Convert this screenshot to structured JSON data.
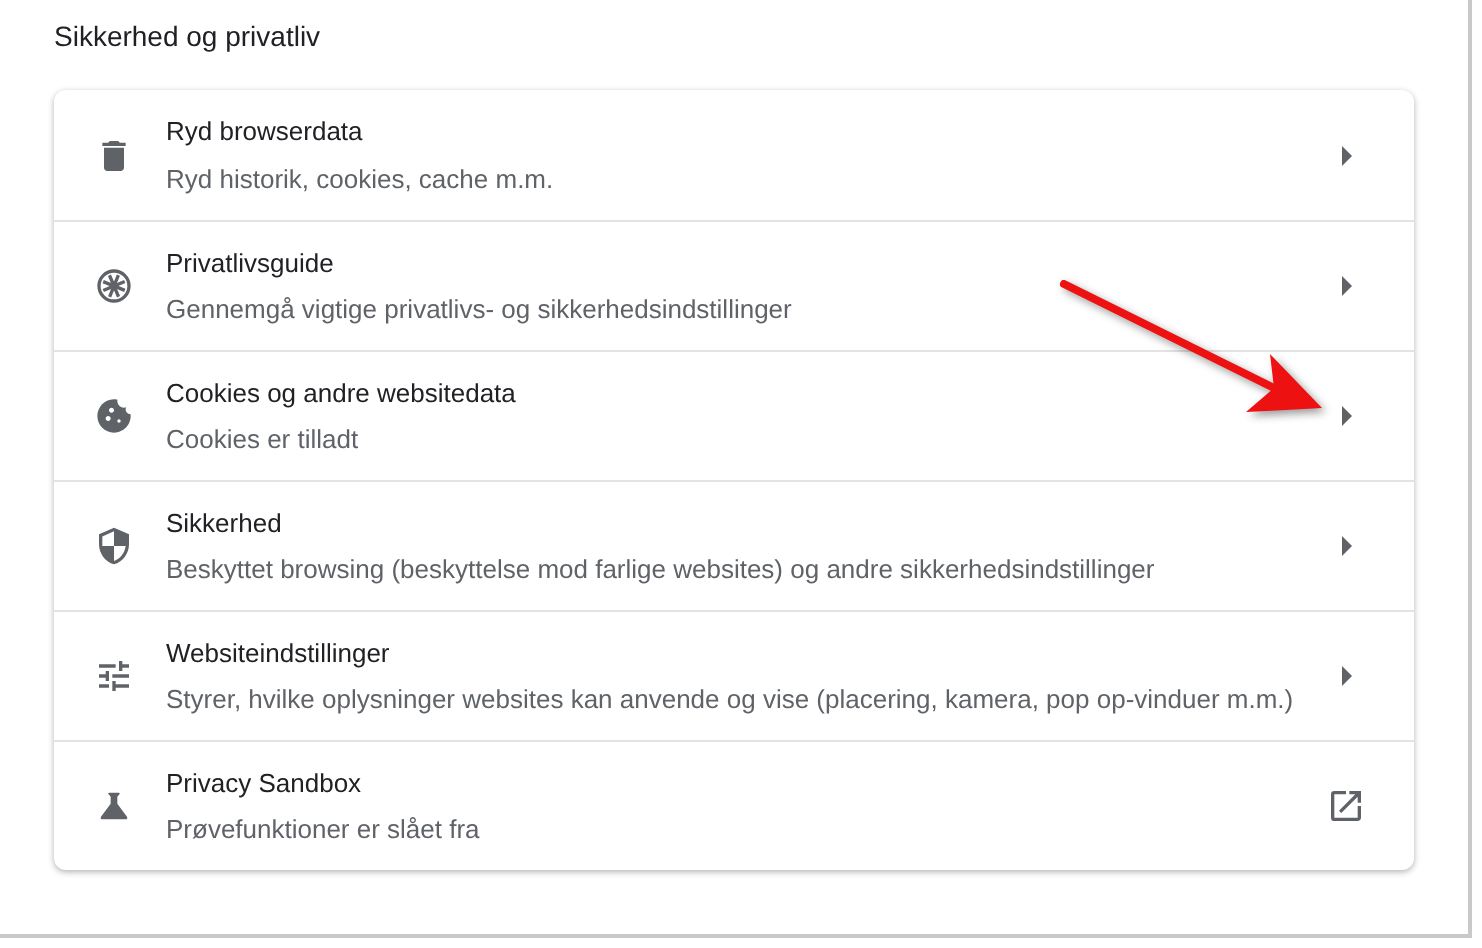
{
  "section_title": "Sikkerhed og privatliv",
  "items": [
    {
      "title": "Ryd browserdata",
      "subtitle": "Ryd historik, cookies, cache m.m.",
      "kind": "arrow"
    },
    {
      "title": "Privatlivsguide",
      "subtitle": "Gennemgå vigtige privatlivs- og sikkerhedsindstillinger",
      "kind": "arrow"
    },
    {
      "title": "Cookies og andre websitedata",
      "subtitle": "Cookies er tilladt",
      "kind": "arrow"
    },
    {
      "title": "Sikkerhed",
      "subtitle": "Beskyttet browsing (beskyttelse mod farlige websites) og andre sikkerhedsindstillinger",
      "kind": "arrow"
    },
    {
      "title": "Websiteindstillinger",
      "subtitle": "Styrer, hvilke oplysninger websites kan anvende og vise (placering, kamera, pop op-vinduer m.m.)",
      "kind": "arrow"
    },
    {
      "title": "Privacy Sandbox",
      "subtitle": "Prøvefunktioner er slået fra",
      "kind": "external"
    }
  ]
}
